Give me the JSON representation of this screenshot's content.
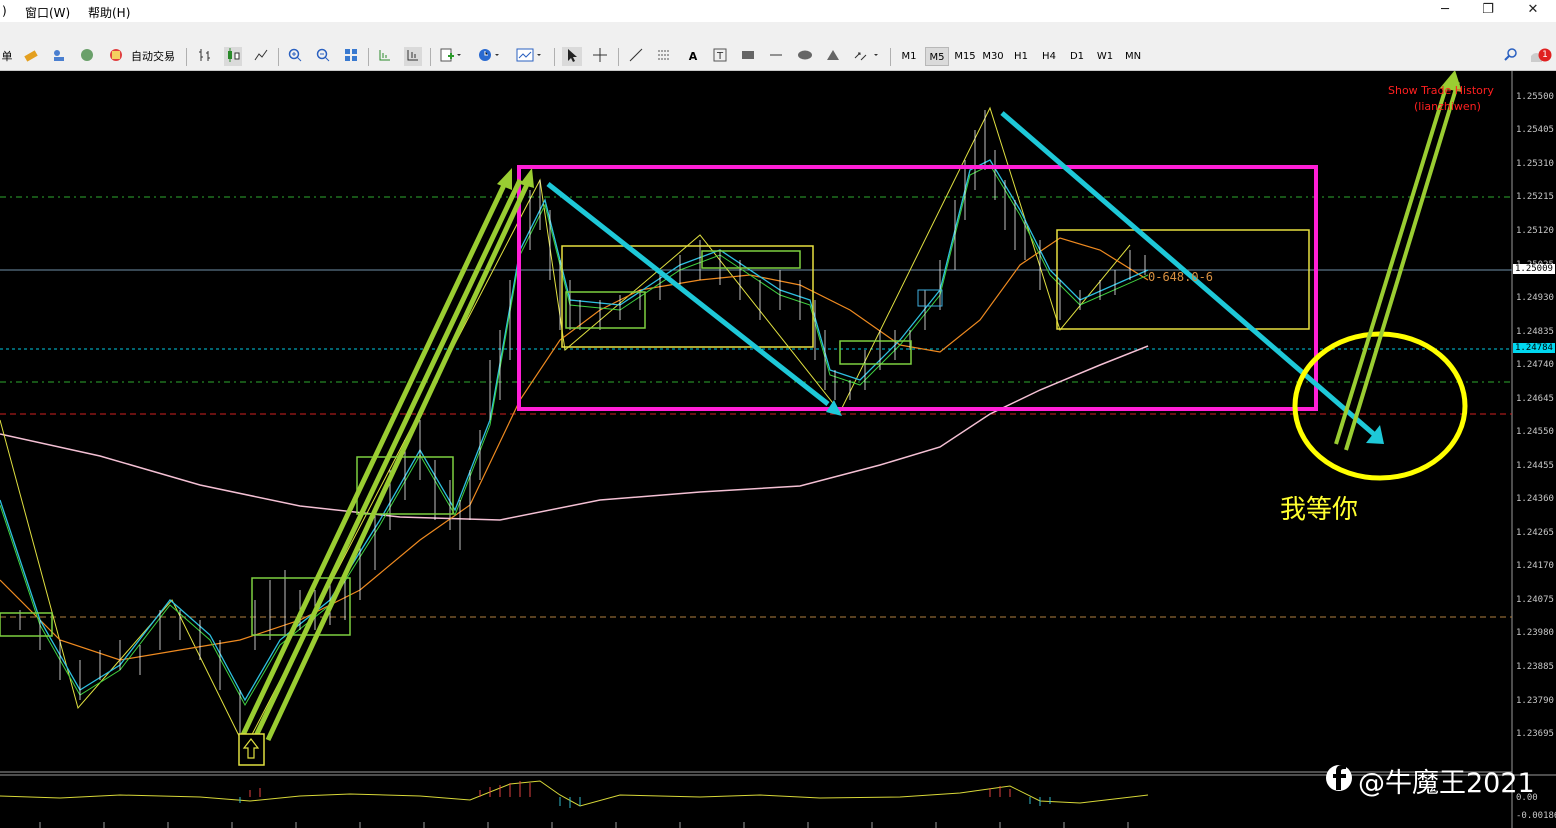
{
  "menu": {
    "items": [
      ")",
      "窗口(W)",
      "帮助(H)"
    ]
  },
  "window_controls": {
    "minimize": "─",
    "restore": "❐",
    "close": "✕"
  },
  "toolbar": {
    "order_label": "单",
    "autotrade_label": "自动交易",
    "timeframes": [
      "M1",
      "M5",
      "M15",
      "M30",
      "H1",
      "H4",
      "D1",
      "W1",
      "MN"
    ],
    "active_timeframe": "M5",
    "notification_count": "1"
  },
  "chart": {
    "indicator_title": "Show Trade History",
    "indicator_author": "(lianzhiwen)",
    "fib_label": "0-648.0-6",
    "annotation": "我等你",
    "watermark": "@牛魔王2021",
    "price_axis": [
      "1.25500",
      "1.25405",
      "1.25310",
      "1.25215",
      "1.25120",
      "1.25025",
      "1.24930",
      "1.24835",
      "1.24740",
      "1.24645",
      "1.24550",
      "1.24455",
      "1.24360",
      "1.24265",
      "1.24170",
      "1.24075",
      "1.23980",
      "1.23885",
      "1.23790",
      "1.23695"
    ],
    "current_price": "1.25009",
    "bid_line_price": "1.24784",
    "subwindow_axis": [
      "0.00",
      "-0.00186"
    ],
    "colors": {
      "background": "#000000",
      "magenta_box": "#ff1fd6",
      "green_arrow": "#9acd32",
      "cyan_arrow": "#1ec8d8",
      "yellow_circle": "#ffff00",
      "current_price_tag": "#ffffff",
      "bid_tag": "#00e0ff"
    }
  }
}
